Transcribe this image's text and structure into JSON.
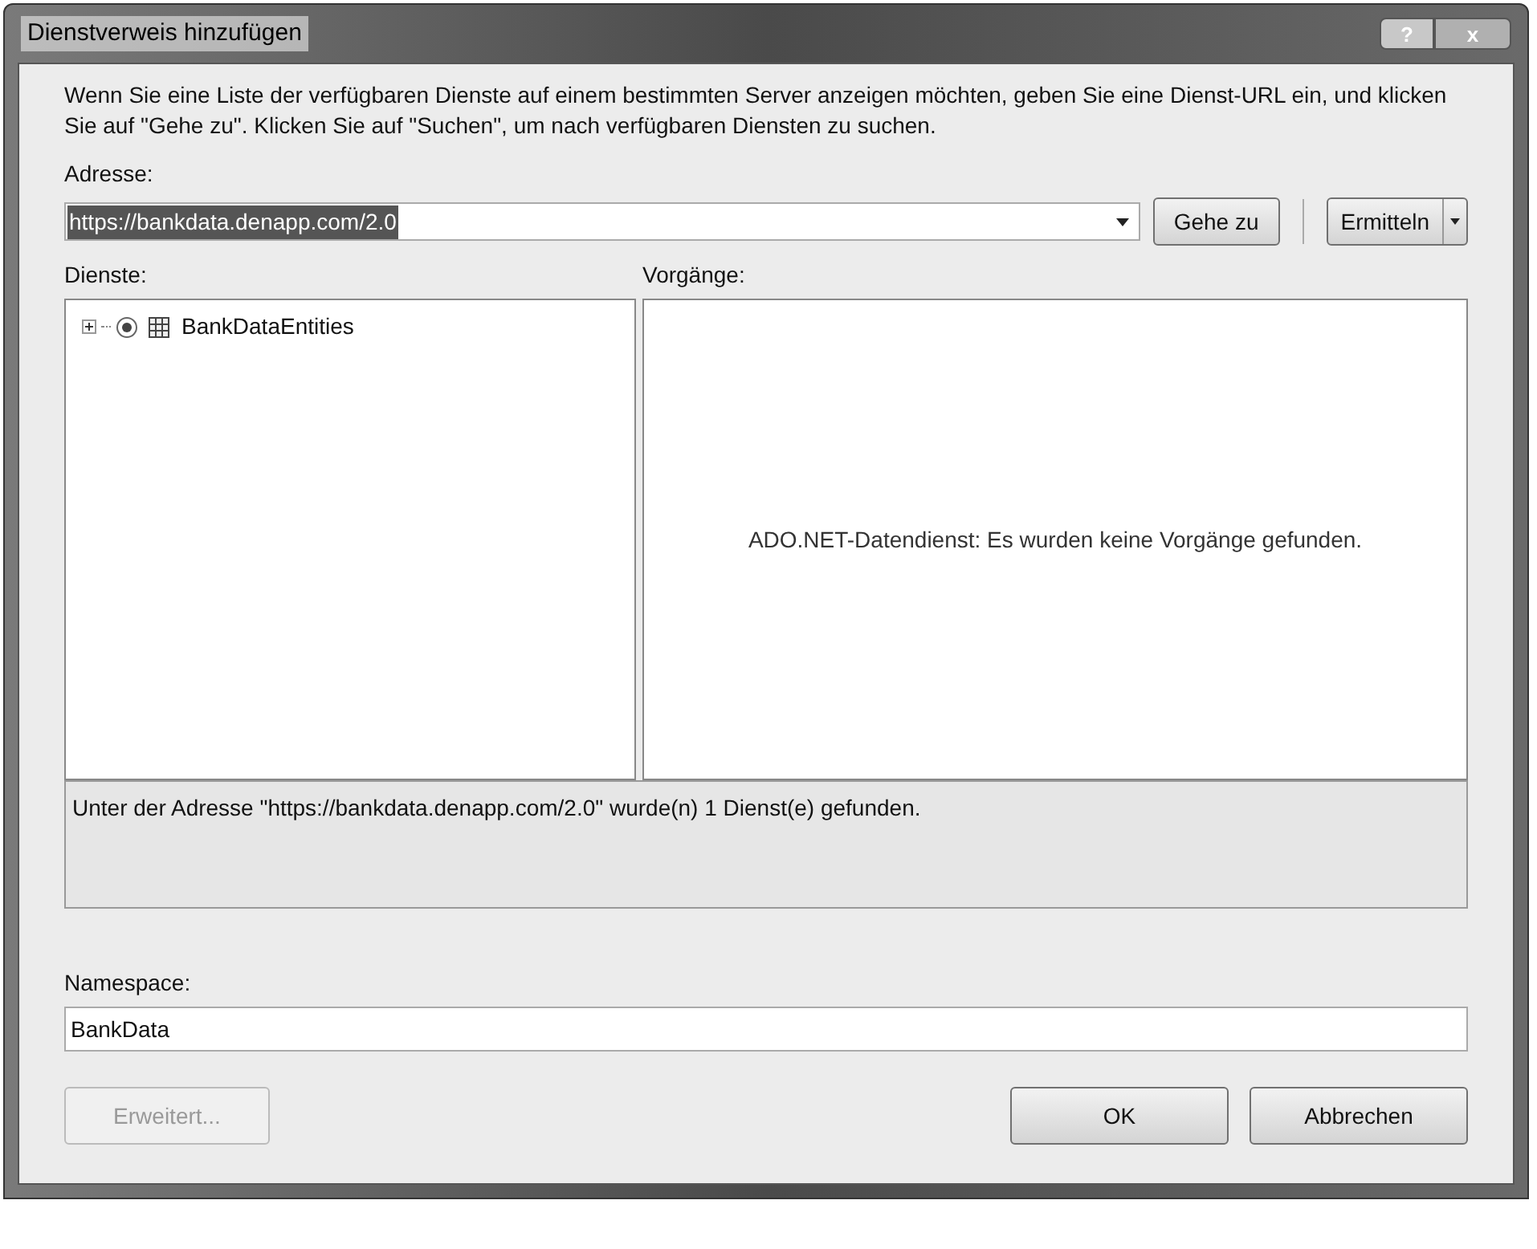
{
  "window": {
    "title": "Dienstverweis hinzufügen",
    "help": "?",
    "close": "x"
  },
  "intro": "Wenn Sie eine Liste der verfügbaren Dienste auf einem bestimmten Server anzeigen möchten, geben Sie eine Dienst-URL ein, und klicken Sie auf \"Gehe zu\". Klicken Sie auf \"Suchen\", um nach verfügbaren Diensten zu suchen.",
  "address": {
    "label": "Adresse:",
    "value": "https://bankdata.denapp.com/2.0",
    "selected": true
  },
  "go_button": "Gehe zu",
  "discover_button": "Ermitteln",
  "services": {
    "label": "Dienste:",
    "items": [
      {
        "label": "BankDataEntities",
        "expanded": false
      }
    ]
  },
  "operations": {
    "label": "Vorgänge:",
    "message": "ADO.NET-Datendienst: Es wurden keine Vorgänge gefunden."
  },
  "status": "Unter der Adresse \"https://bankdata.denapp.com/2.0\" wurde(n) 1 Dienst(e) gefunden.",
  "namespace": {
    "label": "Namespace:",
    "value": "BankData"
  },
  "buttons": [
    {
      "label": "Erweitert...",
      "disabled": true
    },
    {
      "label": "OK",
      "disabled": false
    },
    {
      "label": "Abbrechen",
      "disabled": false
    }
  ]
}
